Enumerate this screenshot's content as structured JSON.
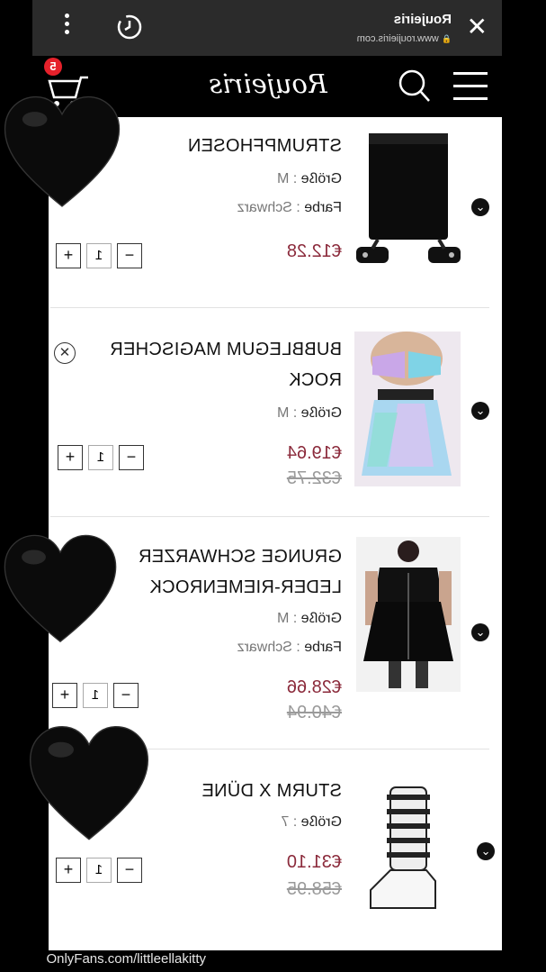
{
  "browser": {
    "site_title": "Roujeiris",
    "site_url": "www.roujieiris.com",
    "close_label": "✕"
  },
  "header": {
    "logo_text": "Roujeiris",
    "cart_count": "5"
  },
  "cart": {
    "items": [
      {
        "name_lines": [
          "STRUMPFHOSEN"
        ],
        "size_label": "Größe",
        "size_value": "M",
        "color_label": "Farbe",
        "color_value": "Schwarz",
        "price": "€12.28",
        "old_price": "",
        "quantity": "1"
      },
      {
        "name_lines": [
          "BUBBLEGUM MAGISCHER",
          "ROCK"
        ],
        "size_label": "Größe",
        "size_value": "M",
        "color_label": "",
        "color_value": "",
        "price": "€19.64",
        "old_price": "€32.75",
        "quantity": "1"
      },
      {
        "name_lines": [
          "GRUNGE SCHWARZER",
          "LEDER-RIEMENROCK"
        ],
        "size_label": "Größe",
        "size_value": "M",
        "color_label": "Farbe",
        "color_value": "Schwarz",
        "price": "€28.66",
        "old_price": "€40.94",
        "quantity": "1"
      },
      {
        "name_lines": [
          "STURM X DÜNE"
        ],
        "size_label": "Größe",
        "size_value": "7",
        "color_label": "",
        "color_value": "",
        "price": "€31.10",
        "old_price": "€58.95",
        "quantity": "1"
      }
    ],
    "minus_label": "−",
    "plus_label": "+",
    "remove_label": "✕"
  },
  "watermark": "OnlyFans.com/littleellakitty",
  "colors": {
    "price": "#8b2a3b",
    "badge": "#e6212b",
    "topbar": "#2b2b2b"
  }
}
